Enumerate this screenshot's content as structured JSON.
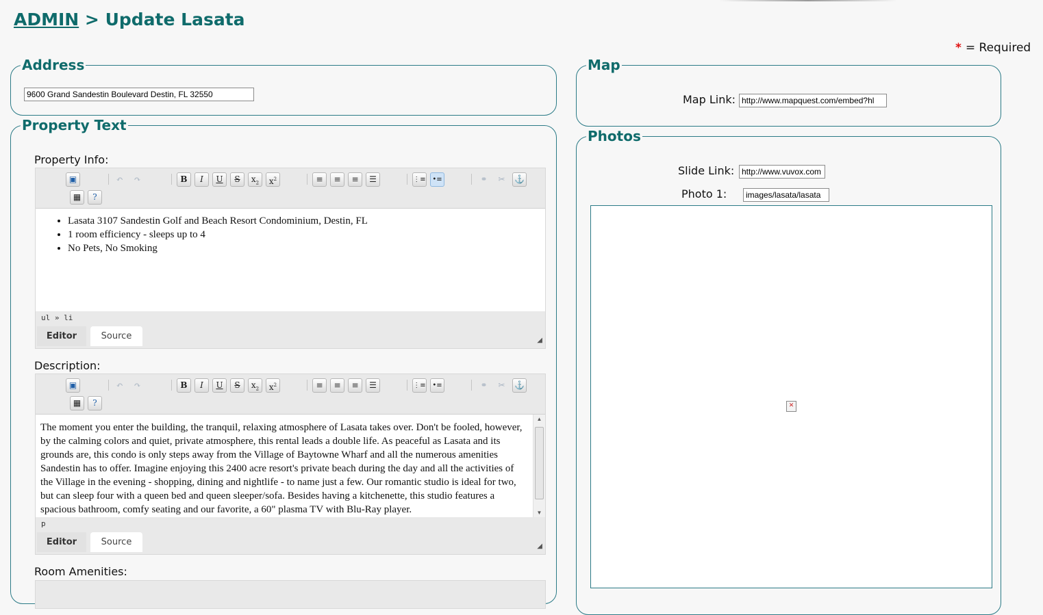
{
  "header": {
    "admin_link": "ADMIN",
    "separator": ">",
    "title": "Update Lasata"
  },
  "required_note": {
    "star": "*",
    "label": "= Required"
  },
  "address": {
    "legend": "Address",
    "value": "9600 Grand Sandestin Boulevard  Destin, FL 32550"
  },
  "map": {
    "legend": "Map",
    "label": "Map Link:",
    "value": "http://www.mapquest.com/embed?hl"
  },
  "property_text": {
    "legend": "Property Text",
    "property_info": {
      "label": "Property Info:",
      "items": [
        "Lasata 3107 Sandestin Golf and Beach Resort Condominium, Destin, FL",
        "1 room efficiency - sleeps up to 4",
        "No Pets, No Smoking"
      ],
      "path": "ul » li",
      "tab_editor": "Editor",
      "tab_source": "Source"
    },
    "description": {
      "label": "Description:",
      "text": "The moment you enter the building, the tranquil, relaxing atmosphere of Lasata takes over. Don't be fooled, however, by the calming colors and quiet, private atmosphere, this rental leads a double life. As peaceful as Lasata and its grounds are, this condo is only steps away from the Village of Baytowne Wharf and all the numerous amenities Sandestin has to offer. Imagine enjoying this 2400 acre resort's private beach during the day and all the activities of the Village in the evening - shopping, dining and nightlife - to name just a few. Our romantic studio is ideal for two, but can sleep four with a queen bed and queen sleeper/sofa. Besides having a kitchenette, this studio features a spacious bathroom, comfy seating and our favorite, a 60\" plasma TV with Blu-Ray player.",
      "path": "p",
      "tab_editor": "Editor",
      "tab_source": "Source"
    },
    "room_amenities": {
      "label": "Room Amenities:"
    }
  },
  "photos": {
    "legend": "Photos",
    "slide_label": "Slide Link:",
    "slide_value": "http://www.vuvox.com",
    "photo1_label": "Photo 1:",
    "photo1_value": "images/lasata/lasata"
  },
  "toolbar_icons": [
    "save-icon",
    "undo-icon",
    "redo-icon",
    "bold",
    "italic",
    "underline",
    "strikethrough",
    "subscript",
    "superscript",
    "align-left",
    "align-center",
    "align-right",
    "justify",
    "ordered-list",
    "unordered-list",
    "link-icon",
    "unlink-icon",
    "anchor-icon",
    "maximize-icon",
    "help-icon"
  ],
  "colors": {
    "heading": "#0f6b6b",
    "border": "#2a7a86",
    "required_star": "#e01010"
  }
}
